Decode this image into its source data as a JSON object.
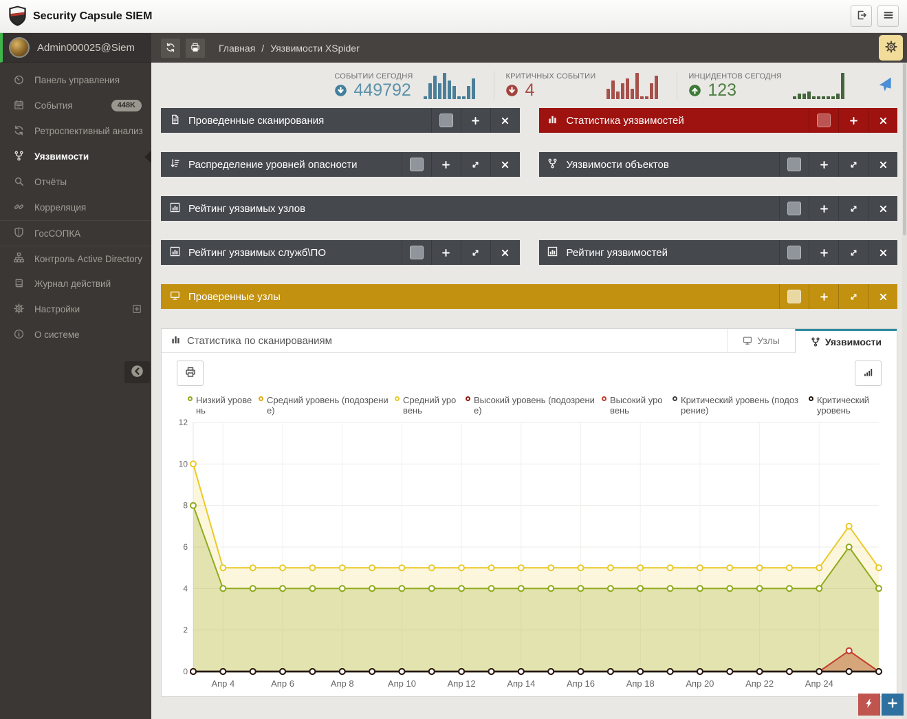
{
  "app": {
    "title": "Security Capsule SIEM"
  },
  "topbar": {
    "buttons": [
      {
        "name": "logout",
        "icon": "logout"
      },
      {
        "name": "menu",
        "icon": "hamburger"
      }
    ]
  },
  "sidebar": {
    "user": "Admin000025@Siem",
    "items": [
      {
        "name": "dashboard",
        "label": "Панель управления",
        "icon": "gauge"
      },
      {
        "name": "events",
        "label": "События",
        "icon": "calendar",
        "badge": "448K"
      },
      {
        "name": "retrospective",
        "label": "Ретроспективный анализ",
        "icon": "refresh"
      },
      {
        "name": "vulnerabilities",
        "label": "Уязвимости",
        "icon": "fork",
        "active": true
      },
      {
        "name": "reports",
        "label": "Отчёты",
        "icon": "search"
      },
      {
        "name": "correlation",
        "label": "Корреляция",
        "icon": "link"
      },
      {
        "name": "gossopka",
        "label": "ГосСОПКА",
        "icon": "shield",
        "divider_before": true
      },
      {
        "name": "ad-control",
        "label": "Контроль Active Directory",
        "icon": "sitemap",
        "divider_before": true
      },
      {
        "name": "action-log",
        "label": "Журнал действий",
        "icon": "book"
      },
      {
        "name": "settings",
        "label": "Настройки",
        "icon": "gear",
        "expandable": true
      },
      {
        "name": "about",
        "label": "О системе",
        "icon": "info"
      }
    ]
  },
  "breadcrumb": {
    "home": "Главная",
    "separator": "/",
    "current": "Уязвимости XSpider"
  },
  "stats": [
    {
      "name": "events-today",
      "label": "СОБЫТИИ СЕГОДНЯ",
      "value": "449792",
      "direction": "down",
      "value_color": "#5d92aa",
      "icon_color": "#41809c",
      "bar_color": "#4b7f99",
      "spark": [
        1,
        6,
        9,
        6,
        10,
        7,
        5,
        1,
        1,
        5,
        8
      ]
    },
    {
      "name": "critical-events",
      "label": "КРИТИЧНЫХ СОБЫТИИ",
      "value": "4",
      "direction": "down",
      "value_color": "#a94b45",
      "icon_color": "#a4433d",
      "bar_color": "#a8504a",
      "spark": [
        4,
        7,
        3,
        6,
        8,
        4,
        10,
        1,
        1,
        6,
        9
      ]
    },
    {
      "name": "incidents-today",
      "label": "ИНЦИДЕНТОВ СЕГОДНЯ",
      "value": "123",
      "direction": "up",
      "value_color": "#4f7f44",
      "icon_color": "#3d7a36",
      "bar_color": "#44663c",
      "spark": [
        1,
        2,
        2,
        3,
        1,
        1,
        1,
        1,
        1,
        2,
        10
      ]
    }
  ],
  "panels": {
    "rows": [
      [
        {
          "name": "scans",
          "title": "Проведенные сканирования",
          "icon": "file",
          "theme": "dark",
          "controls": [
            "swatch",
            "plus",
            "close"
          ]
        },
        {
          "name": "vuln-stats",
          "title": "Статистика уязвимостей",
          "icon": "bars",
          "theme": "red",
          "controls": [
            "swatch",
            "plus",
            "close"
          ]
        }
      ],
      [
        {
          "name": "severity-distribution",
          "title": "Распределение уровней опасности",
          "icon": "sort",
          "theme": "dark",
          "controls": [
            "swatch",
            "plus",
            "expand",
            "close"
          ]
        },
        {
          "name": "object-vulns",
          "title": "Уязвимости объектов",
          "icon": "fork",
          "theme": "dark",
          "controls": [
            "swatch",
            "plus",
            "expand",
            "close"
          ]
        }
      ],
      [
        {
          "name": "vulnerable-hosts-rating",
          "title": "Рейтинг уязвимых узлов",
          "icon": "chartbox",
          "theme": "dark",
          "controls": [
            "swatch",
            "plus",
            "expand",
            "close"
          ]
        }
      ],
      [
        {
          "name": "vulnerable-services-rating",
          "title": "Рейтинг уязвимых служб\\ПО",
          "icon": "chartbox",
          "theme": "dark",
          "controls": [
            "swatch",
            "plus",
            "expand",
            "close"
          ]
        },
        {
          "name": "vulnerabilities-rating",
          "title": "Рейтинг уязвимостей",
          "icon": "chartbox",
          "theme": "dark",
          "controls": [
            "swatch",
            "plus",
            "expand",
            "close"
          ]
        }
      ],
      [
        {
          "name": "checked-hosts",
          "title": "Проверенные узлы",
          "icon": "monitor",
          "theme": "gold",
          "controls": [
            "swatch",
            "plus",
            "expand",
            "close"
          ]
        }
      ]
    ]
  },
  "chart_panel": {
    "title": "Статистика по сканированиям",
    "tabs": [
      {
        "name": "nodes",
        "label": "Узлы",
        "icon": "monitor",
        "active": false
      },
      {
        "name": "vulnerabilities",
        "label": "Уязвимости",
        "icon": "fork",
        "active": true
      }
    ]
  },
  "chart_data": {
    "type": "line",
    "title": "Статистика по сканированиям",
    "x_axis": {
      "tick_labels": [
        "Апр 4",
        "Апр 6",
        "Апр 8",
        "Апр 10",
        "Апр 12",
        "Апр 14",
        "Апр 16",
        "Апр 18",
        "Апр 20",
        "Апр 22",
        "Апр 24"
      ],
      "first_tick_point_index": 1,
      "points_between_ticks": 2,
      "total_points": 24,
      "point_dates": "daily from Апр 3 to Апр 26"
    },
    "y_axis": {
      "min": 0,
      "max": 12,
      "ticks": [
        0,
        2,
        4,
        6,
        8,
        10,
        12
      ],
      "grid": true
    },
    "legend_position": "top",
    "series": [
      {
        "name": "Низкий уровень",
        "color": "#8faa1b",
        "fill": "rgba(150,170,40,0.25)",
        "legend_width": "narrow",
        "values": [
          8,
          4,
          4,
          4,
          4,
          4,
          4,
          4,
          4,
          4,
          4,
          4,
          4,
          4,
          4,
          4,
          4,
          4,
          4,
          4,
          4,
          4,
          6,
          4
        ]
      },
      {
        "name": "Средний уровень (подозрение)",
        "color": "#dfad10",
        "legend_width": "wide",
        "values": [
          0,
          0,
          0,
          0,
          0,
          0,
          0,
          0,
          0,
          0,
          0,
          0,
          0,
          0,
          0,
          0,
          0,
          0,
          0,
          0,
          0,
          0,
          0,
          0
        ]
      },
      {
        "name": "Средний уровень",
        "color": "#eac929",
        "fill": "rgba(234,201,41,0.16)",
        "legend_width": "narrow",
        "values": [
          10,
          5,
          5,
          5,
          5,
          5,
          5,
          5,
          5,
          5,
          5,
          5,
          5,
          5,
          5,
          5,
          5,
          5,
          5,
          5,
          5,
          5,
          7,
          5
        ]
      },
      {
        "name": "Высокий уровень (подозрение)",
        "color": "#9a1a0d",
        "legend_width": "wide",
        "values": [
          0,
          0,
          0,
          0,
          0,
          0,
          0,
          0,
          0,
          0,
          0,
          0,
          0,
          0,
          0,
          0,
          0,
          0,
          0,
          0,
          0,
          0,
          0,
          0
        ]
      },
      {
        "name": "Высокий уровень",
        "color": "#c53b2b",
        "fill": "rgba(197,90,60,0.45)",
        "legend_width": "narrow",
        "values": [
          0,
          0,
          0,
          0,
          0,
          0,
          0,
          0,
          0,
          0,
          0,
          0,
          0,
          0,
          0,
          0,
          0,
          0,
          0,
          0,
          0,
          0,
          1,
          0
        ]
      },
      {
        "name": "Критический уровень (подозрение)",
        "color": "#3f3f3f",
        "legend_width": "wide",
        "values": [
          0,
          0,
          0,
          0,
          0,
          0,
          0,
          0,
          0,
          0,
          0,
          0,
          0,
          0,
          0,
          0,
          0,
          0,
          0,
          0,
          0,
          0,
          0,
          0
        ]
      },
      {
        "name": "Критический уровень",
        "color": "#261a12",
        "legend_width": "narrow",
        "values": [
          0,
          0,
          0,
          0,
          0,
          0,
          0,
          0,
          0,
          0,
          0,
          0,
          0,
          0,
          0,
          0,
          0,
          0,
          0,
          0,
          0,
          0,
          0,
          0
        ]
      }
    ]
  },
  "floating_buttons": [
    {
      "name": "quick-action",
      "icon": "bolt",
      "color": "#c05550"
    },
    {
      "name": "add-widget",
      "icon": "plus",
      "color": "#2e709f"
    }
  ],
  "toolbar": {
    "print": "print",
    "chart_type": "signal"
  }
}
